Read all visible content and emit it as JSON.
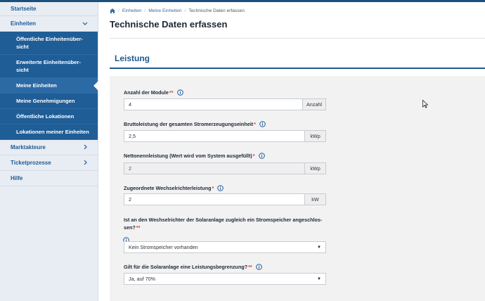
{
  "sidebar": {
    "items": [
      {
        "label": "Startseite"
      },
      {
        "label": "Einheiten"
      },
      {
        "label": "Marktakteure"
      },
      {
        "label": "Ticketprozesse"
      },
      {
        "label": "Hilfe"
      }
    ],
    "subitems": [
      {
        "label": "Öffentliche Einheitenüber- sicht"
      },
      {
        "label": "Erweiterte Einheitenüber- sicht"
      },
      {
        "label": "Meine Einheiten"
      },
      {
        "label": "Meine Genehmigungen"
      },
      {
        "label": "Öffentliche Lokationen"
      },
      {
        "label": "Lokationen meiner Einheiten"
      }
    ]
  },
  "breadcrumb": {
    "items": [
      {
        "label": "Einheiten"
      },
      {
        "label": "Meine Einheiten"
      },
      {
        "label": "Technische Daten erfassen"
      }
    ]
  },
  "page": {
    "title": "Technische Daten erfassen",
    "section_title": "Leistung"
  },
  "form": {
    "modules": {
      "label": "Anzahl der Module",
      "req": "**",
      "value": "4",
      "unit": "Anzahl"
    },
    "gross": {
      "label": "Bruttoleistung der gesamten Stromerzeugungseinheit",
      "req": "*",
      "value": "2,5",
      "unit": "kWp"
    },
    "net": {
      "label": "Nettonennleistung (Wert wird vom System ausgefüllt)",
      "req": "*",
      "value": "2",
      "unit": "kWp"
    },
    "inverter": {
      "label": "Zugeordnete Wechselrichterleistung",
      "req": "*",
      "value": "2",
      "unit": "kW"
    },
    "storage": {
      "label_line1": "Ist an den Wechselrichter der Solaranlage zugleich ein Stromspeicher angeschlos-",
      "label_line2": "sen?",
      "req": "**",
      "value": "Kein Stromspeicher vorhanden"
    },
    "limit": {
      "label": "Gilt für die Solaranlage eine Leistungsbegrenzung?",
      "req": "**",
      "value": "Ja, auf 70%"
    }
  }
}
